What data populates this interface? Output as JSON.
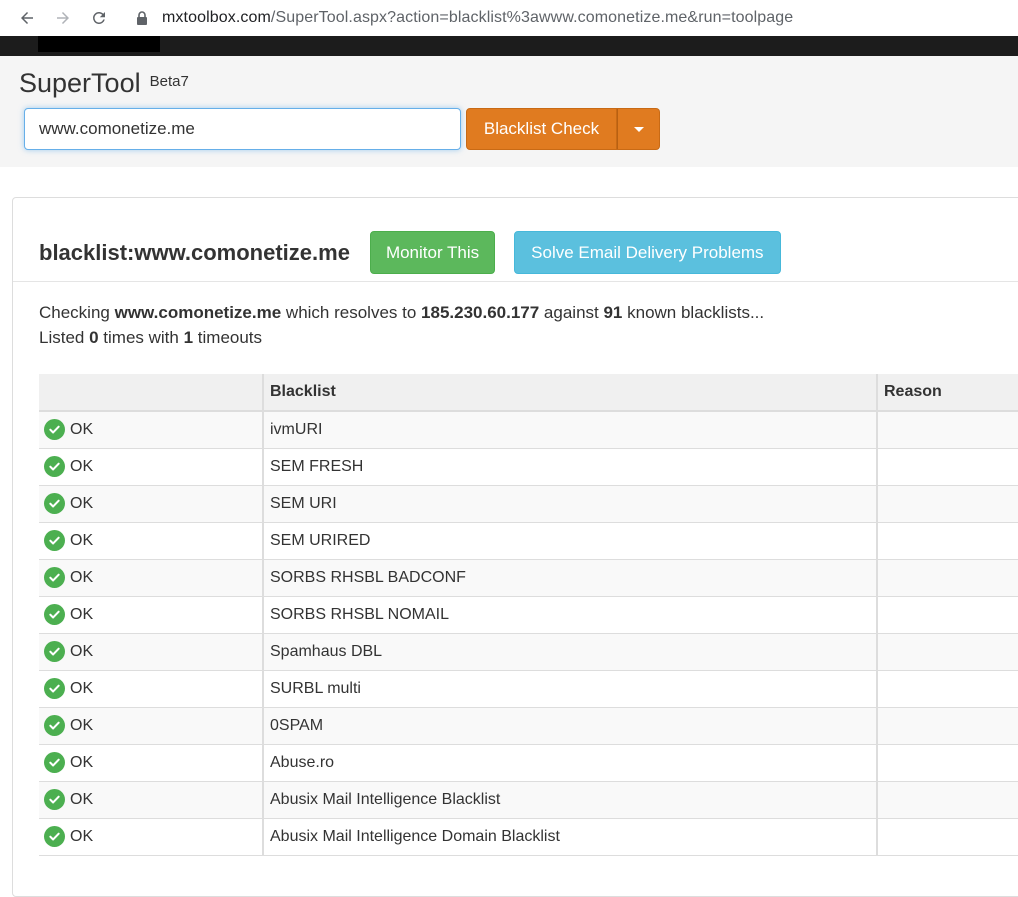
{
  "browser": {
    "url_domain": "mxtoolbox.com",
    "url_path": "/SuperTool.aspx?action=blacklist%3awww.comonetize.me&run=toolpage"
  },
  "header": {
    "brand": "SuperTool",
    "beta": "Beta7",
    "search_value": "www.comonetize.me",
    "action_label": "Blacklist Check"
  },
  "result": {
    "title": "blacklist:www.comonetize.me",
    "monitor_label": "Monitor This",
    "solve_label": "Solve Email Delivery Problems",
    "summary": {
      "p1": "Checking ",
      "host": "www.comonetize.me",
      "p2": " which resolves to ",
      "ip": "185.230.60.177",
      "p3": " against ",
      "count": "91",
      "p4": " known blacklists...",
      "p5": "Listed ",
      "listed": "0",
      "p6": " times with ",
      "timeouts": "1",
      "p7": " timeouts"
    }
  },
  "table": {
    "headers": [
      "",
      "Blacklist",
      "Reason"
    ],
    "rows": [
      {
        "status": "OK",
        "blacklist": "ivmURI",
        "reason": ""
      },
      {
        "status": "OK",
        "blacklist": "SEM FRESH",
        "reason": ""
      },
      {
        "status": "OK",
        "blacklist": "SEM URI",
        "reason": ""
      },
      {
        "status": "OK",
        "blacklist": "SEM URIRED",
        "reason": ""
      },
      {
        "status": "OK",
        "blacklist": "SORBS RHSBL BADCONF",
        "reason": ""
      },
      {
        "status": "OK",
        "blacklist": "SORBS RHSBL NOMAIL",
        "reason": ""
      },
      {
        "status": "OK",
        "blacklist": "Spamhaus DBL",
        "reason": ""
      },
      {
        "status": "OK",
        "blacklist": "SURBL multi",
        "reason": ""
      },
      {
        "status": "OK",
        "blacklist": "0SPAM",
        "reason": ""
      },
      {
        "status": "OK",
        "blacklist": "Abuse.ro",
        "reason": ""
      },
      {
        "status": "OK",
        "blacklist": "Abusix Mail Intelligence Blacklist",
        "reason": ""
      },
      {
        "status": "OK",
        "blacklist": "Abusix Mail Intelligence Domain Blacklist",
        "reason": ""
      }
    ]
  },
  "icons": {
    "back": "arrow-left-icon",
    "forward": "arrow-right-icon",
    "reload": "reload-icon",
    "lock": "lock-icon",
    "caret": "caret-down-icon",
    "ok": "check-circle-icon"
  },
  "colors": {
    "orange": "#e07b20",
    "green": "#5cb85c",
    "blue": "#5bc0de",
    "ok_icon": "#4caf50"
  }
}
